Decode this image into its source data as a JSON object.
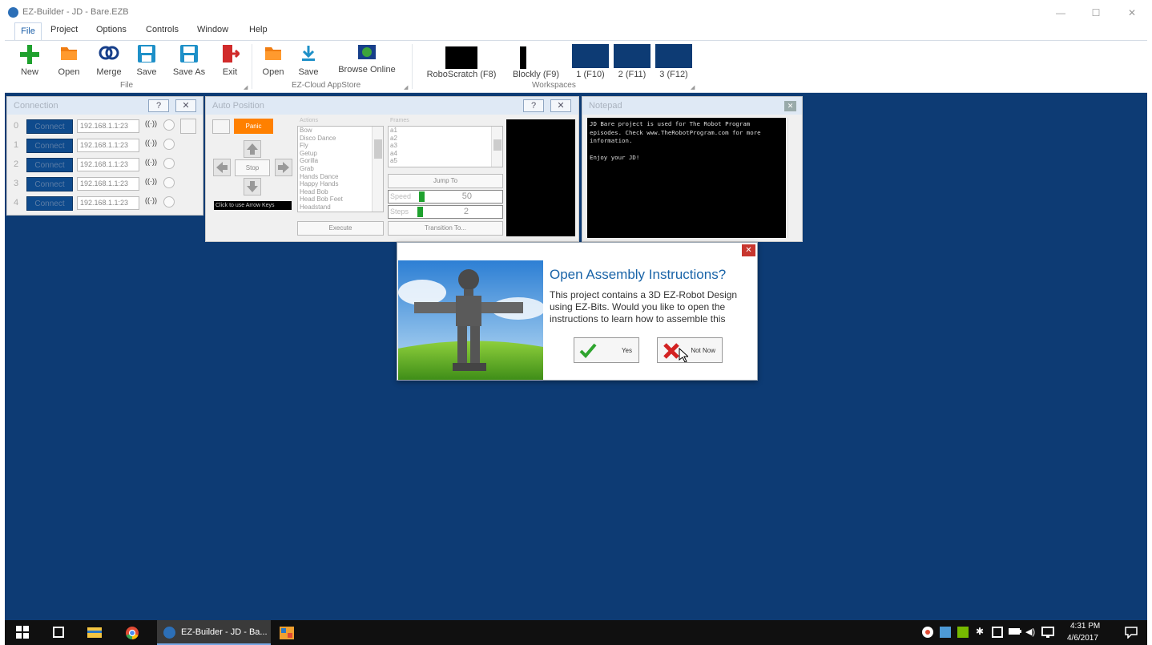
{
  "window": {
    "title": "EZ-Builder - JD - Bare.EZB",
    "controls": {
      "minimize": "—",
      "maximize": "☐",
      "close": "✕"
    }
  },
  "menu": [
    "File",
    "Project",
    "Options",
    "Controls",
    "Window",
    "Help"
  ],
  "ribbon": {
    "file_group": {
      "label": "File",
      "buttons": [
        "New",
        "Open",
        "Merge",
        "Save",
        "Save As",
        "Exit"
      ]
    },
    "cloud_group": {
      "label": "EZ-Cloud AppStore",
      "buttons": [
        "Open",
        "Save",
        "Browse Online"
      ]
    },
    "workspace_group": {
      "label": "Workspaces",
      "buttons": [
        "RoboScratch (F8)",
        "Blockly (F9)",
        "1 (F10)",
        "2 (F11)",
        "3 (F12)"
      ]
    }
  },
  "connection_panel": {
    "title": "Connection",
    "help": "?",
    "close": "✕",
    "rows": [
      {
        "index": "0",
        "button": "Connect",
        "ip": "192.168.1.1:23"
      },
      {
        "index": "1",
        "button": "Connect",
        "ip": "192.168.1.1:23"
      },
      {
        "index": "2",
        "button": "Connect",
        "ip": "192.168.1.1:23"
      },
      {
        "index": "3",
        "button": "Connect",
        "ip": "192.168.1.1:23"
      },
      {
        "index": "4",
        "button": "Connect",
        "ip": "192.168.1.1:23"
      }
    ],
    "wifi_glyph": "((·))"
  },
  "auto_position_panel": {
    "title": "Auto Position",
    "help": "?",
    "close": "✕",
    "panic": "Panic",
    "stop": "Stop",
    "hint": "Click to use Arrow Keys",
    "actions_label": "Actions",
    "actions": [
      "Bow",
      "Disco Dance",
      "Fly",
      "Getup",
      "Gorilla",
      "Grab",
      "Hands Dance",
      "Happy Hands",
      "Head Bob",
      "Head Bob Feet",
      "Headstand"
    ],
    "frames_label": "Frames",
    "frames": [
      "a1",
      "a2",
      "a3",
      "a4",
      "a5"
    ],
    "jump_to": "Jump To",
    "speed_label": "Speed",
    "speed_value": "50",
    "steps_label": "Steps",
    "steps_value": "2",
    "execute": "Execute",
    "transition": "Transition To..."
  },
  "notepad_panel": {
    "title": "Notepad",
    "close": "✕",
    "text": "JD Bare project is used for The Robot Program episodes. Check www.TheRobotProgram.com for more information.\n\nEnjoy your JD!"
  },
  "dialog": {
    "close": "✕",
    "title": "Open Assembly Instructions?",
    "body": "This project contains a 3D EZ-Robot Design using EZ-Bits. Would you like to open the instructions to learn how to assemble this",
    "yes": "Yes",
    "no": "Not Now"
  },
  "taskbar": {
    "app_label": "EZ-Builder - JD - Ba...",
    "time": "4:31 PM",
    "date": "4/6/2017"
  },
  "colors": {
    "desktop": "#0d3b74",
    "panic": "#ff8000",
    "dialog_title": "#1a64a8",
    "connect_button": "#0e4a8c"
  }
}
